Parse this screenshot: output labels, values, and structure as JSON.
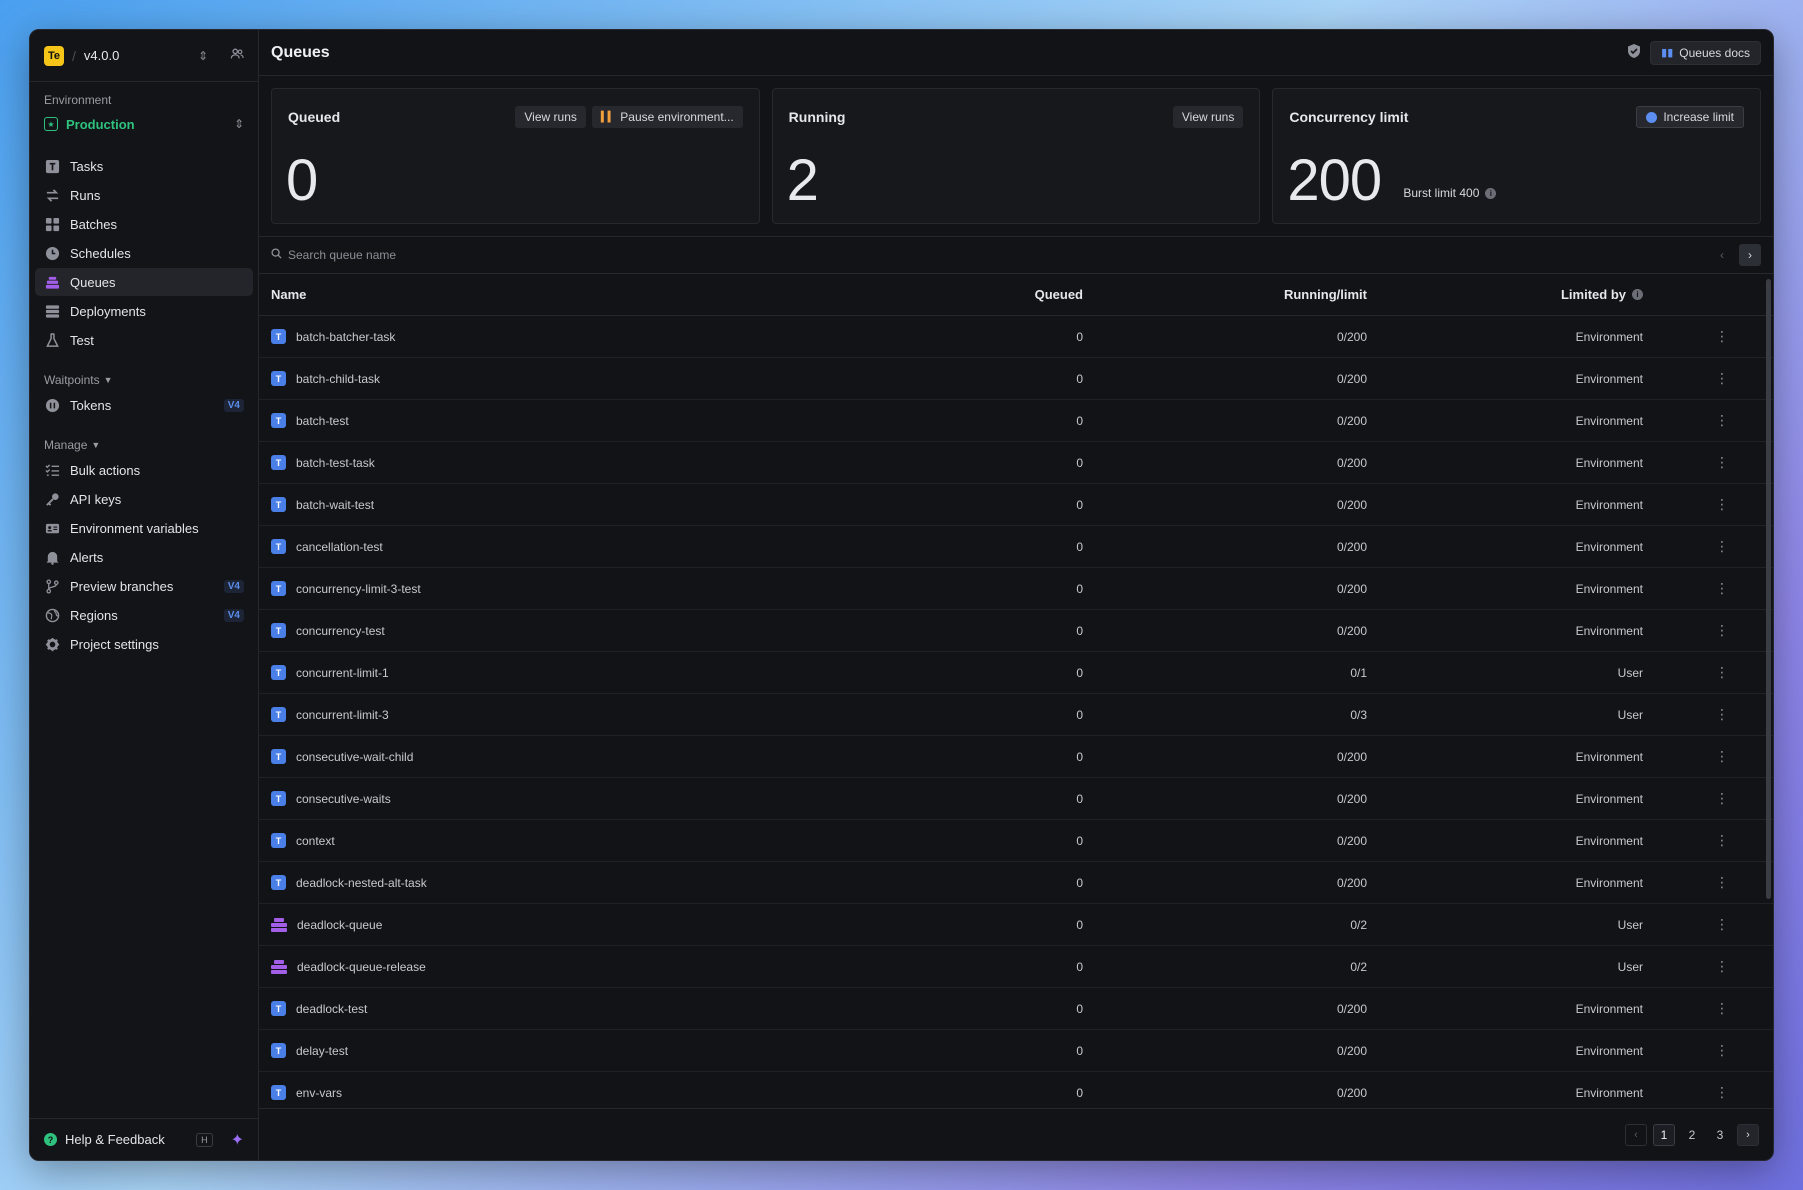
{
  "app": {
    "logo_text": "Te",
    "version": "v4.0.0"
  },
  "sidebar": {
    "environment_label": "Environment",
    "environment_name": "Production",
    "items": [
      {
        "label": "Tasks",
        "icon": "tasks-icon"
      },
      {
        "label": "Runs",
        "icon": "runs-icon"
      },
      {
        "label": "Batches",
        "icon": "batches-icon"
      },
      {
        "label": "Schedules",
        "icon": "schedules-icon"
      },
      {
        "label": "Queues",
        "icon": "queues-icon"
      },
      {
        "label": "Deployments",
        "icon": "deployments-icon"
      },
      {
        "label": "Test",
        "icon": "test-icon"
      }
    ],
    "waitpoints_label": "Waitpoints",
    "waitpoints_items": [
      {
        "label": "Tokens",
        "badge": "V4"
      }
    ],
    "manage_label": "Manage",
    "manage_items": [
      {
        "label": "Bulk actions",
        "badge": ""
      },
      {
        "label": "API keys",
        "badge": ""
      },
      {
        "label": "Environment variables",
        "badge": ""
      },
      {
        "label": "Alerts",
        "badge": ""
      },
      {
        "label": "Preview branches",
        "badge": "V4"
      },
      {
        "label": "Regions",
        "badge": "V4"
      },
      {
        "label": "Project settings",
        "badge": ""
      }
    ],
    "help_label": "Help & Feedback",
    "help_kbd": "H"
  },
  "header": {
    "title": "Queues",
    "docs_label": "Queues docs"
  },
  "cards": {
    "queued": {
      "title": "Queued",
      "value": "0",
      "view_runs": "View runs",
      "pause": "Pause environment..."
    },
    "running": {
      "title": "Running",
      "value": "2",
      "view_runs": "View runs"
    },
    "concurrency": {
      "title": "Concurrency limit",
      "value": "200",
      "increase": "Increase limit",
      "burst": "Burst limit 400"
    }
  },
  "search": {
    "placeholder": "Search queue name"
  },
  "table": {
    "headers": {
      "name": "Name",
      "queued": "Queued",
      "running": "Running/limit",
      "limited_by": "Limited by"
    },
    "rows": [
      {
        "name": "batch-batcher-task",
        "type": "task",
        "queued": "0",
        "running": "0/200",
        "limited_by": "Environment"
      },
      {
        "name": "batch-child-task",
        "type": "task",
        "queued": "0",
        "running": "0/200",
        "limited_by": "Environment"
      },
      {
        "name": "batch-test",
        "type": "task",
        "queued": "0",
        "running": "0/200",
        "limited_by": "Environment"
      },
      {
        "name": "batch-test-task",
        "type": "task",
        "queued": "0",
        "running": "0/200",
        "limited_by": "Environment"
      },
      {
        "name": "batch-wait-test",
        "type": "task",
        "queued": "0",
        "running": "0/200",
        "limited_by": "Environment"
      },
      {
        "name": "cancellation-test",
        "type": "task",
        "queued": "0",
        "running": "0/200",
        "limited_by": "Environment"
      },
      {
        "name": "concurrency-limit-3-test",
        "type": "task",
        "queued": "0",
        "running": "0/200",
        "limited_by": "Environment"
      },
      {
        "name": "concurrency-test",
        "type": "task",
        "queued": "0",
        "running": "0/200",
        "limited_by": "Environment"
      },
      {
        "name": "concurrent-limit-1",
        "type": "task",
        "queued": "0",
        "running": "0/1",
        "limited_by": "User"
      },
      {
        "name": "concurrent-limit-3",
        "type": "task",
        "queued": "0",
        "running": "0/3",
        "limited_by": "User"
      },
      {
        "name": "consecutive-wait-child",
        "type": "task",
        "queued": "0",
        "running": "0/200",
        "limited_by": "Environment"
      },
      {
        "name": "consecutive-waits",
        "type": "task",
        "queued": "0",
        "running": "0/200",
        "limited_by": "Environment"
      },
      {
        "name": "context",
        "type": "task",
        "queued": "0",
        "running": "0/200",
        "limited_by": "Environment"
      },
      {
        "name": "deadlock-nested-alt-task",
        "type": "task",
        "queued": "0",
        "running": "0/200",
        "limited_by": "Environment"
      },
      {
        "name": "deadlock-queue",
        "type": "queue",
        "queued": "0",
        "running": "0/2",
        "limited_by": "User"
      },
      {
        "name": "deadlock-queue-release",
        "type": "queue",
        "queued": "0",
        "running": "0/2",
        "limited_by": "User"
      },
      {
        "name": "deadlock-test",
        "type": "task",
        "queued": "0",
        "running": "0/200",
        "limited_by": "Environment"
      },
      {
        "name": "delay-test",
        "type": "task",
        "queued": "0",
        "running": "0/200",
        "limited_by": "Environment"
      },
      {
        "name": "env-vars",
        "type": "task",
        "queued": "0",
        "running": "0/200",
        "limited_by": "Environment"
      }
    ]
  },
  "pagination": {
    "pages": [
      "1",
      "2",
      "3"
    ],
    "current": "1"
  }
}
